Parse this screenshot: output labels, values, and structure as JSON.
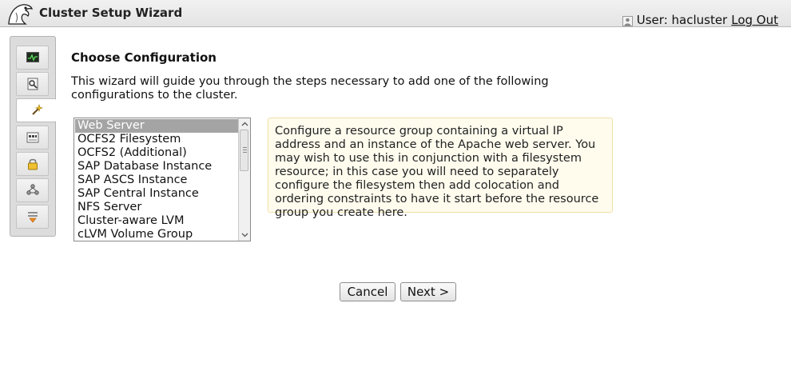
{
  "header": {
    "app_title": "Cluster Setup Wizard",
    "user_label": "User: hacluster",
    "logout_label": "Log Out"
  },
  "sidebar": {
    "items": [
      {
        "icon": "monitor-icon"
      },
      {
        "icon": "config-view-icon"
      },
      {
        "icon": "wizard-wand-icon",
        "active": true
      },
      {
        "icon": "tags-icon"
      },
      {
        "icon": "lock-icon"
      },
      {
        "icon": "nodes-icon"
      },
      {
        "icon": "history-icon"
      }
    ]
  },
  "main": {
    "title": "Choose Configuration",
    "intro": "This wizard will guide you through the steps necessary to add one of the following configurations to the cluster.",
    "configurations": [
      "Web Server",
      "OCFS2 Filesystem",
      "OCFS2 (Additional)",
      "SAP Database Instance",
      "SAP ASCS Instance",
      "SAP Central Instance",
      "NFS Server",
      "Cluster-aware LVM",
      "cLVM Volume Group"
    ],
    "selected_index": 0,
    "description": "Configure a resource group containing a virtual IP address and an instance of the Apache web server. You may wish to use this in conjunction with a filesystem resource; in this case you will need to separately configure the filesystem then add colocation and ordering constraints to have it start before the resource group you create here."
  },
  "buttons": {
    "cancel": "Cancel",
    "next": "Next >"
  },
  "colors": {
    "selection": "#a4a4a4",
    "info_background": "#fffcee",
    "info_border": "#efe0a6"
  }
}
